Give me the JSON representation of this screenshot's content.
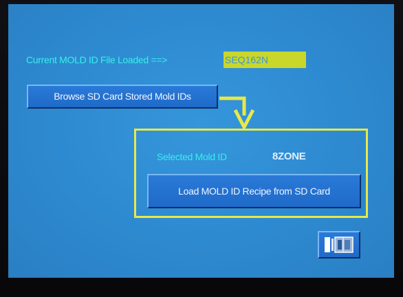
{
  "screen": {
    "current_label": "Current MOLD ID File Loaded ==>",
    "current_value": "SEQ162N",
    "browse_button_label": "Browse SD Card Stored Mold IDs",
    "selected_label": "Selected Mold ID",
    "selected_value": "8ZONE",
    "load_button_label": "Load MOLD ID Recipe from SD Card",
    "exit_icon": "door-exit-icon"
  },
  "colors": {
    "screen_background": "#2f8fd6",
    "label_text": "#36f0ea",
    "highlight_yellow": "#e8e84a",
    "value_field": "#c9d62a",
    "button_face": "#2a7ad8"
  }
}
